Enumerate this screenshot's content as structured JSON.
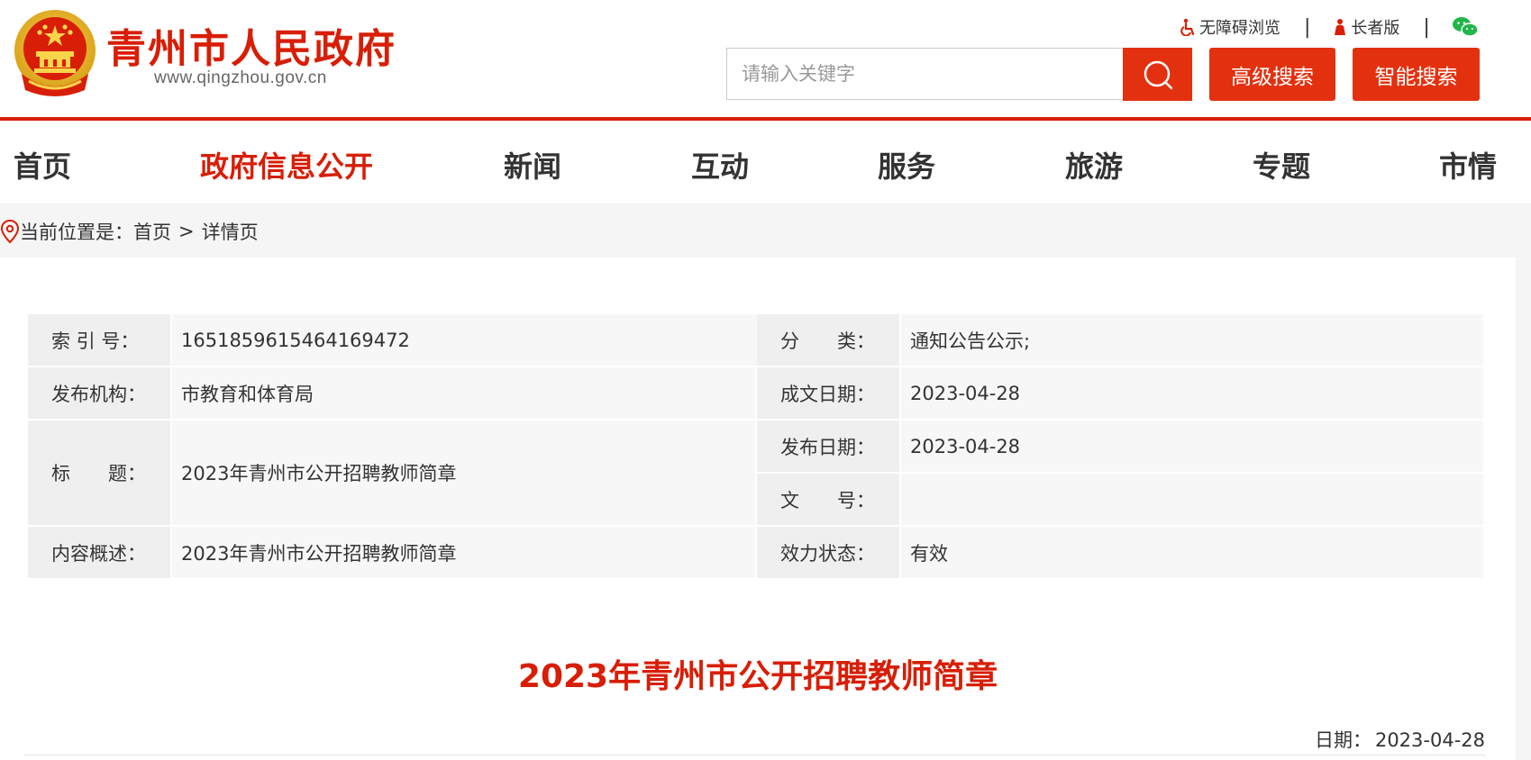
{
  "header": {
    "site_name": "青州市人民政府",
    "site_domain": "www.qingzhou.gov.cn",
    "accessibility_label": "无障碍浏览",
    "elder_label": "长者版",
    "separator": "|",
    "search_placeholder": "请输入关键字",
    "advanced_search_label": "高级搜索",
    "smart_search_label": "智能搜索",
    "accent_color": "#d81e06",
    "button_color": "#e3310f",
    "wechat_color": "#21b64a"
  },
  "nav": {
    "items": [
      {
        "label": "首页",
        "active": false
      },
      {
        "label": "政府信息公开",
        "active": true
      },
      {
        "label": "新闻",
        "active": false
      },
      {
        "label": "互动",
        "active": false
      },
      {
        "label": "服务",
        "active": false
      },
      {
        "label": "旅游",
        "active": false
      },
      {
        "label": "专题",
        "active": false
      },
      {
        "label": "市情",
        "active": false
      }
    ]
  },
  "breadcrumb": {
    "prefix": "当前位置是：",
    "home": "首页",
    "gt": ">",
    "current": "详情页"
  },
  "meta": {
    "index_label": "索 引 号：",
    "index_value": "1651859615464169472",
    "category_label": "分　　类：",
    "category_value": "通知公告公示;",
    "publisher_label": "发布机构：",
    "publisher_value": "市教育和体育局",
    "written_date_label": "成文日期：",
    "written_date_value": "2023-04-28",
    "title_label": "标　　题：",
    "title_value": "2023年青州市公开招聘教师简章",
    "publish_date_label": "发布日期：",
    "publish_date_value": "2023-04-28",
    "doc_no_label": "文　　号：",
    "doc_no_value": "",
    "summary_label": "内容概述：",
    "summary_value": "2023年青州市公开招聘教师简章",
    "status_label": "效力状态：",
    "status_value": "有效"
  },
  "article": {
    "title": "2023年青州市公开招聘教师简章",
    "date_label": "日期：",
    "date_value": "2023-04-28"
  }
}
